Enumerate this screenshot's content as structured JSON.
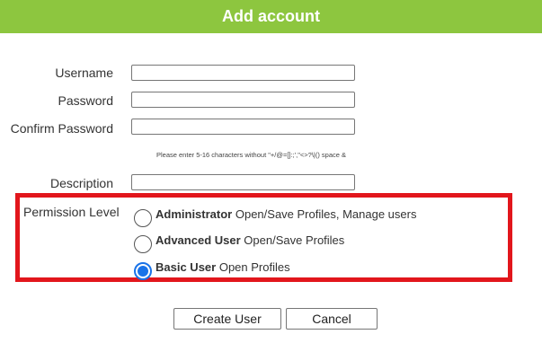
{
  "dialog": {
    "title": "Add account"
  },
  "form": {
    "username_label": "Username",
    "username_value": "",
    "password_label": "Password",
    "password_value": "",
    "confirm_label": "Confirm Password",
    "confirm_value": "",
    "hint": "Please enter 5-16 characters without \"+/@=[]:;',\"<>?\\|() space &",
    "description_label": "Description",
    "description_value": ""
  },
  "permission": {
    "label": "Permission Level",
    "options": [
      {
        "title": "Administrator",
        "desc": "Open/Save Profiles, Manage users",
        "selected": false
      },
      {
        "title": "Advanced User",
        "desc": "Open/Save Profiles",
        "selected": false
      },
      {
        "title": "Basic User",
        "desc": "Open Profiles",
        "selected": true
      }
    ],
    "highlight_color": "#e2161c",
    "selected_color": "#1a73e8"
  },
  "buttons": {
    "create": "Create User",
    "cancel": "Cancel"
  },
  "colors": {
    "title_bar": "#8dc63f"
  }
}
